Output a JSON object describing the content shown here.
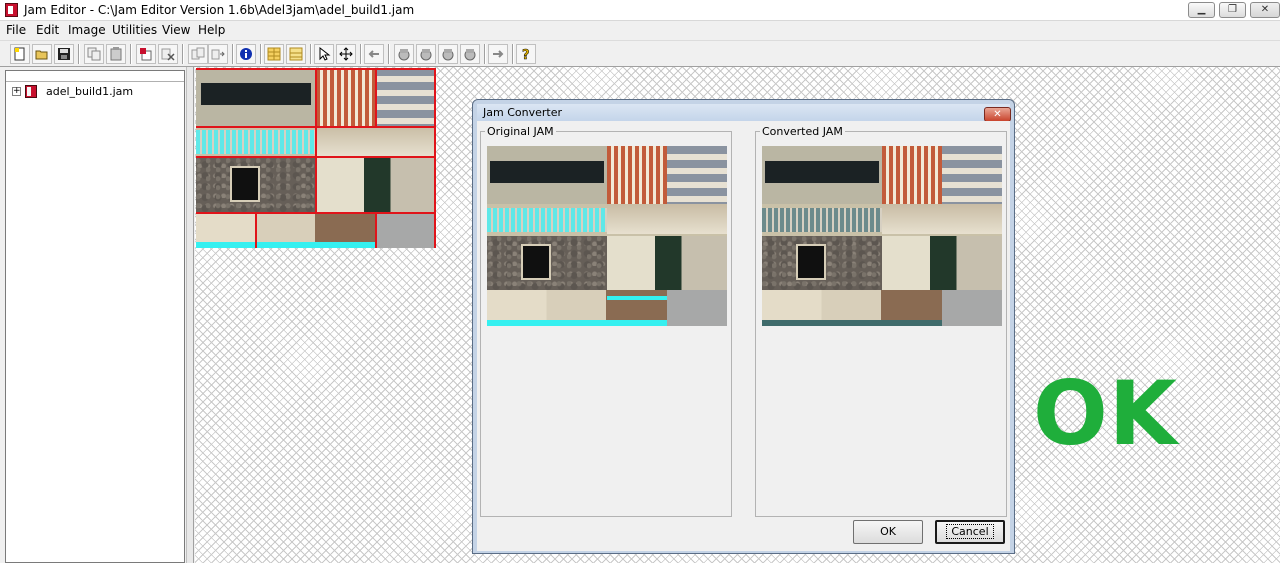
{
  "window": {
    "title": "Jam Editor - C:\\Jam Editor Version 1.6b\\Adel3jam\\adel_build1.jam",
    "minimize_label": "▁",
    "restore_label": "❐",
    "close_label": "✕"
  },
  "menu": [
    "File",
    "Edit",
    "Image",
    "Utilities",
    "View",
    "Help"
  ],
  "toolbar": {
    "icons": [
      "new-file-icon",
      "open-file-icon",
      "save-icon",
      "copy-icon",
      "paste-icon",
      "import-icon",
      "delete-icon",
      "duplicate-icon",
      "move-icon",
      "info-icon",
      "grid-icon",
      "grid-alt-icon",
      "pointer-icon",
      "move-cross-icon",
      "arrow-left-icon",
      "hand-icon",
      "hand2-icon",
      "hand3-icon",
      "hand4-icon",
      "arrow-right-icon",
      "help-icon"
    ]
  },
  "tree": {
    "expander": "+",
    "root_label": "adel_build1.jam"
  },
  "dialog": {
    "title": "Jam Converter",
    "close_label": "✕",
    "original_label": "Original JAM",
    "converted_label": "Converted JAM",
    "ok_label": "OK",
    "cancel_label": "Cancel"
  },
  "overlay": {
    "stamp_text": "OK",
    "stamp_color": "#1fae3b"
  }
}
